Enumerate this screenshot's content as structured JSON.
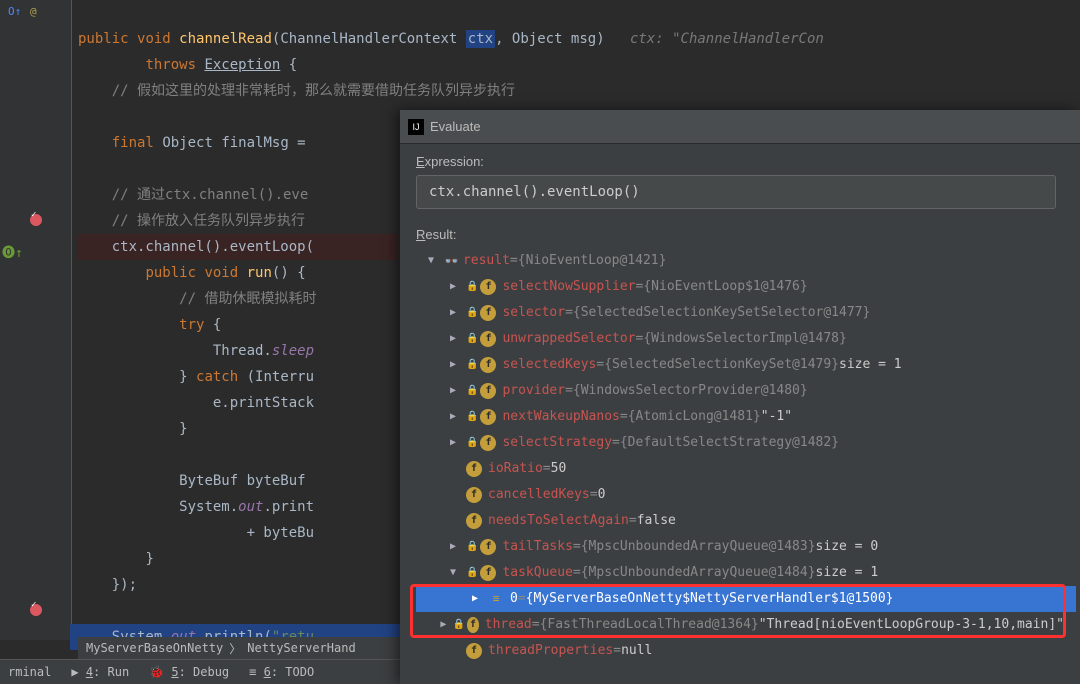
{
  "code": {
    "l1_public": "public",
    "l1_void": "void",
    "l1_method": "channelRead",
    "l1_params": "(ChannelHandlerContext",
    "l1_ctx": "ctx",
    "l1_rest": ", Object msg)",
    "l1_hint": "ctx: \"ChannelHandlerCon",
    "l2_throws": "throws",
    "l2_exception": "Exception",
    "l2_brace": " {",
    "l3_comment": "// 假如这里的处理非常耗时，那么就需要借助任务队列异步执行",
    "l5_final": "final",
    "l5_object": "Object finalMsg =",
    "l7_comment": "// 通过ctx.channel().eve",
    "l8_comment": "// 操作放入任务队列异步执行",
    "l9": "ctx.channel().eventLoop(",
    "l10_public": "public",
    "l10_void": "void",
    "l10_run": "run",
    "l10_paren": "() {",
    "l11_comment": "// 借助休眠模拟耗时",
    "l12_try": "try",
    "l12_brace": " {",
    "l13_thread": "Thread.",
    "l13_sleep": "sleep",
    "l14_catch": "} ",
    "l14_catch2": "catch",
    "l14_catch3": " (Interru",
    "l15": "e.printStack",
    "l16_brace": "}",
    "l18": "ByteBuf byteBuf",
    "l19_sys": "System.",
    "l19_out": "out",
    "l19_print": ".print",
    "l20": "+ byteBu",
    "l21_brace": "}",
    "l22_end": "});",
    "l24_sys": "System.",
    "l24_out": "out",
    "l24_print": ".println(",
    "l24_str": "\"retu"
  },
  "breadcrumb1": "MyServerBaseOnNetty",
  "breadcrumb2": "NettyServerHand",
  "bottom": {
    "terminal": "rminal",
    "run": "4: Run",
    "debug": "5: Debug",
    "todo": "6: TODO"
  },
  "evaluate": {
    "title": "Evaluate",
    "exprLabel": "Expression:",
    "exprValue": "ctx.channel().eventLoop()",
    "resultLabel": "Result:",
    "rows": [
      {
        "indent": 0,
        "arrow": "▼",
        "icon": "glasses",
        "name": "result",
        "eq": " = ",
        "val": "{NioEventLoop@1421}",
        "valcls": "val-grey"
      },
      {
        "indent": 1,
        "arrow": "▶",
        "icon": "f",
        "lock": true,
        "name": "selectNowSupplier",
        "eq": " = ",
        "val": "{NioEventLoop$1@1476}",
        "valcls": "val-grey"
      },
      {
        "indent": 1,
        "arrow": "▶",
        "icon": "f",
        "lock": true,
        "name": "selector",
        "eq": " = ",
        "val": "{SelectedSelectionKeySetSelector@1477}",
        "valcls": "val-grey"
      },
      {
        "indent": 1,
        "arrow": "▶",
        "icon": "f",
        "lock": true,
        "name": "unwrappedSelector",
        "eq": " = ",
        "val": "{WindowsSelectorImpl@1478}",
        "valcls": "val-grey"
      },
      {
        "indent": 1,
        "arrow": "▶",
        "icon": "f",
        "lock": true,
        "name": "selectedKeys",
        "eq": " = ",
        "val": "{SelectedSelectionKeySet@1479}",
        "valcls": "val-grey",
        "extra": "  size = 1"
      },
      {
        "indent": 1,
        "arrow": "▶",
        "icon": "f",
        "lock": true,
        "name": "provider",
        "eq": " = ",
        "val": "{WindowsSelectorProvider@1480}",
        "valcls": "val-grey"
      },
      {
        "indent": 1,
        "arrow": "▶",
        "icon": "f",
        "lock": true,
        "name": "nextWakeupNanos",
        "eq": " = ",
        "val": "{AtomicLong@1481}",
        "valcls": "val-grey",
        "extra": " \"-1\""
      },
      {
        "indent": 1,
        "arrow": "▶",
        "icon": "f",
        "lock": true,
        "name": "selectStrategy",
        "eq": " = ",
        "val": "{DefaultSelectStrategy@1482}",
        "valcls": "val-grey"
      },
      {
        "indent": 1,
        "arrow": "",
        "icon": "f",
        "name": "ioRatio",
        "eq": " = ",
        "val": "50",
        "valcls": "val-white",
        "namecls": "name-red"
      },
      {
        "indent": 1,
        "arrow": "",
        "icon": "f",
        "name": "cancelledKeys",
        "eq": " = ",
        "val": "0",
        "valcls": "val-white",
        "namecls": "name-red"
      },
      {
        "indent": 1,
        "arrow": "",
        "icon": "f",
        "name": "needsToSelectAgain",
        "eq": " = ",
        "val": "false",
        "valcls": "val-white",
        "namecls": "name-red"
      },
      {
        "indent": 1,
        "arrow": "▶",
        "icon": "f",
        "lock": true,
        "name": "tailTasks",
        "eq": " = ",
        "val": "{MpscUnboundedArrayQueue@1483}",
        "valcls": "val-grey",
        "extra": "  size = 0"
      },
      {
        "indent": 1,
        "arrow": "▼",
        "icon": "f",
        "lock": true,
        "name": "taskQueue",
        "eq": " = ",
        "val": "{MpscUnboundedArrayQueue@1484}",
        "valcls": "val-grey",
        "extra": "  size = 1"
      },
      {
        "indent": 2,
        "arrow": "▶",
        "icon": "idx",
        "name": "0",
        "eq": " = ",
        "val": "{MyServerBaseOnNetty$NettyServerHandler$1@1500}",
        "valcls": "val-grey",
        "selected": true,
        "namecls": "name-idx"
      },
      {
        "indent": 1,
        "arrow": "▶",
        "icon": "f",
        "lock": true,
        "name": "thread",
        "eq": " = ",
        "val": "{FastThreadLocalThread@1364}",
        "valcls": "val-grey",
        "extra": " \"Thread[nioEventLoopGroup-3-1,10,main]\""
      },
      {
        "indent": 1,
        "arrow": "",
        "icon": "f",
        "name": "threadProperties",
        "eq": " = ",
        "val": "null",
        "valcls": "val-white",
        "namecls": "name-red"
      }
    ]
  }
}
